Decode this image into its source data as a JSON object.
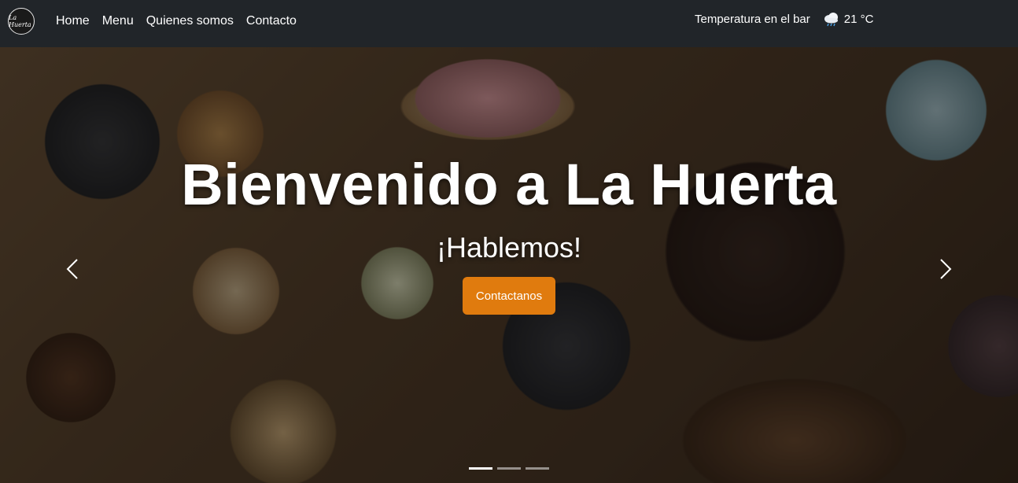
{
  "navbar": {
    "logo_text": "La Huerta",
    "links": [
      {
        "label": "Home"
      },
      {
        "label": "Menu"
      },
      {
        "label": "Quienes somos"
      },
      {
        "label": "Contacto"
      }
    ]
  },
  "weather": {
    "label": "Temperatura en el bar",
    "icon": "rain-cloud-icon",
    "value": "21 °C"
  },
  "hero": {
    "title": "Bienvenido a La Huerta",
    "subtitle": "¡Hablemos!",
    "cta_label": "Contactanos",
    "cta_color": "#e07b0e",
    "active_slide": 1,
    "slide_count": 3
  }
}
